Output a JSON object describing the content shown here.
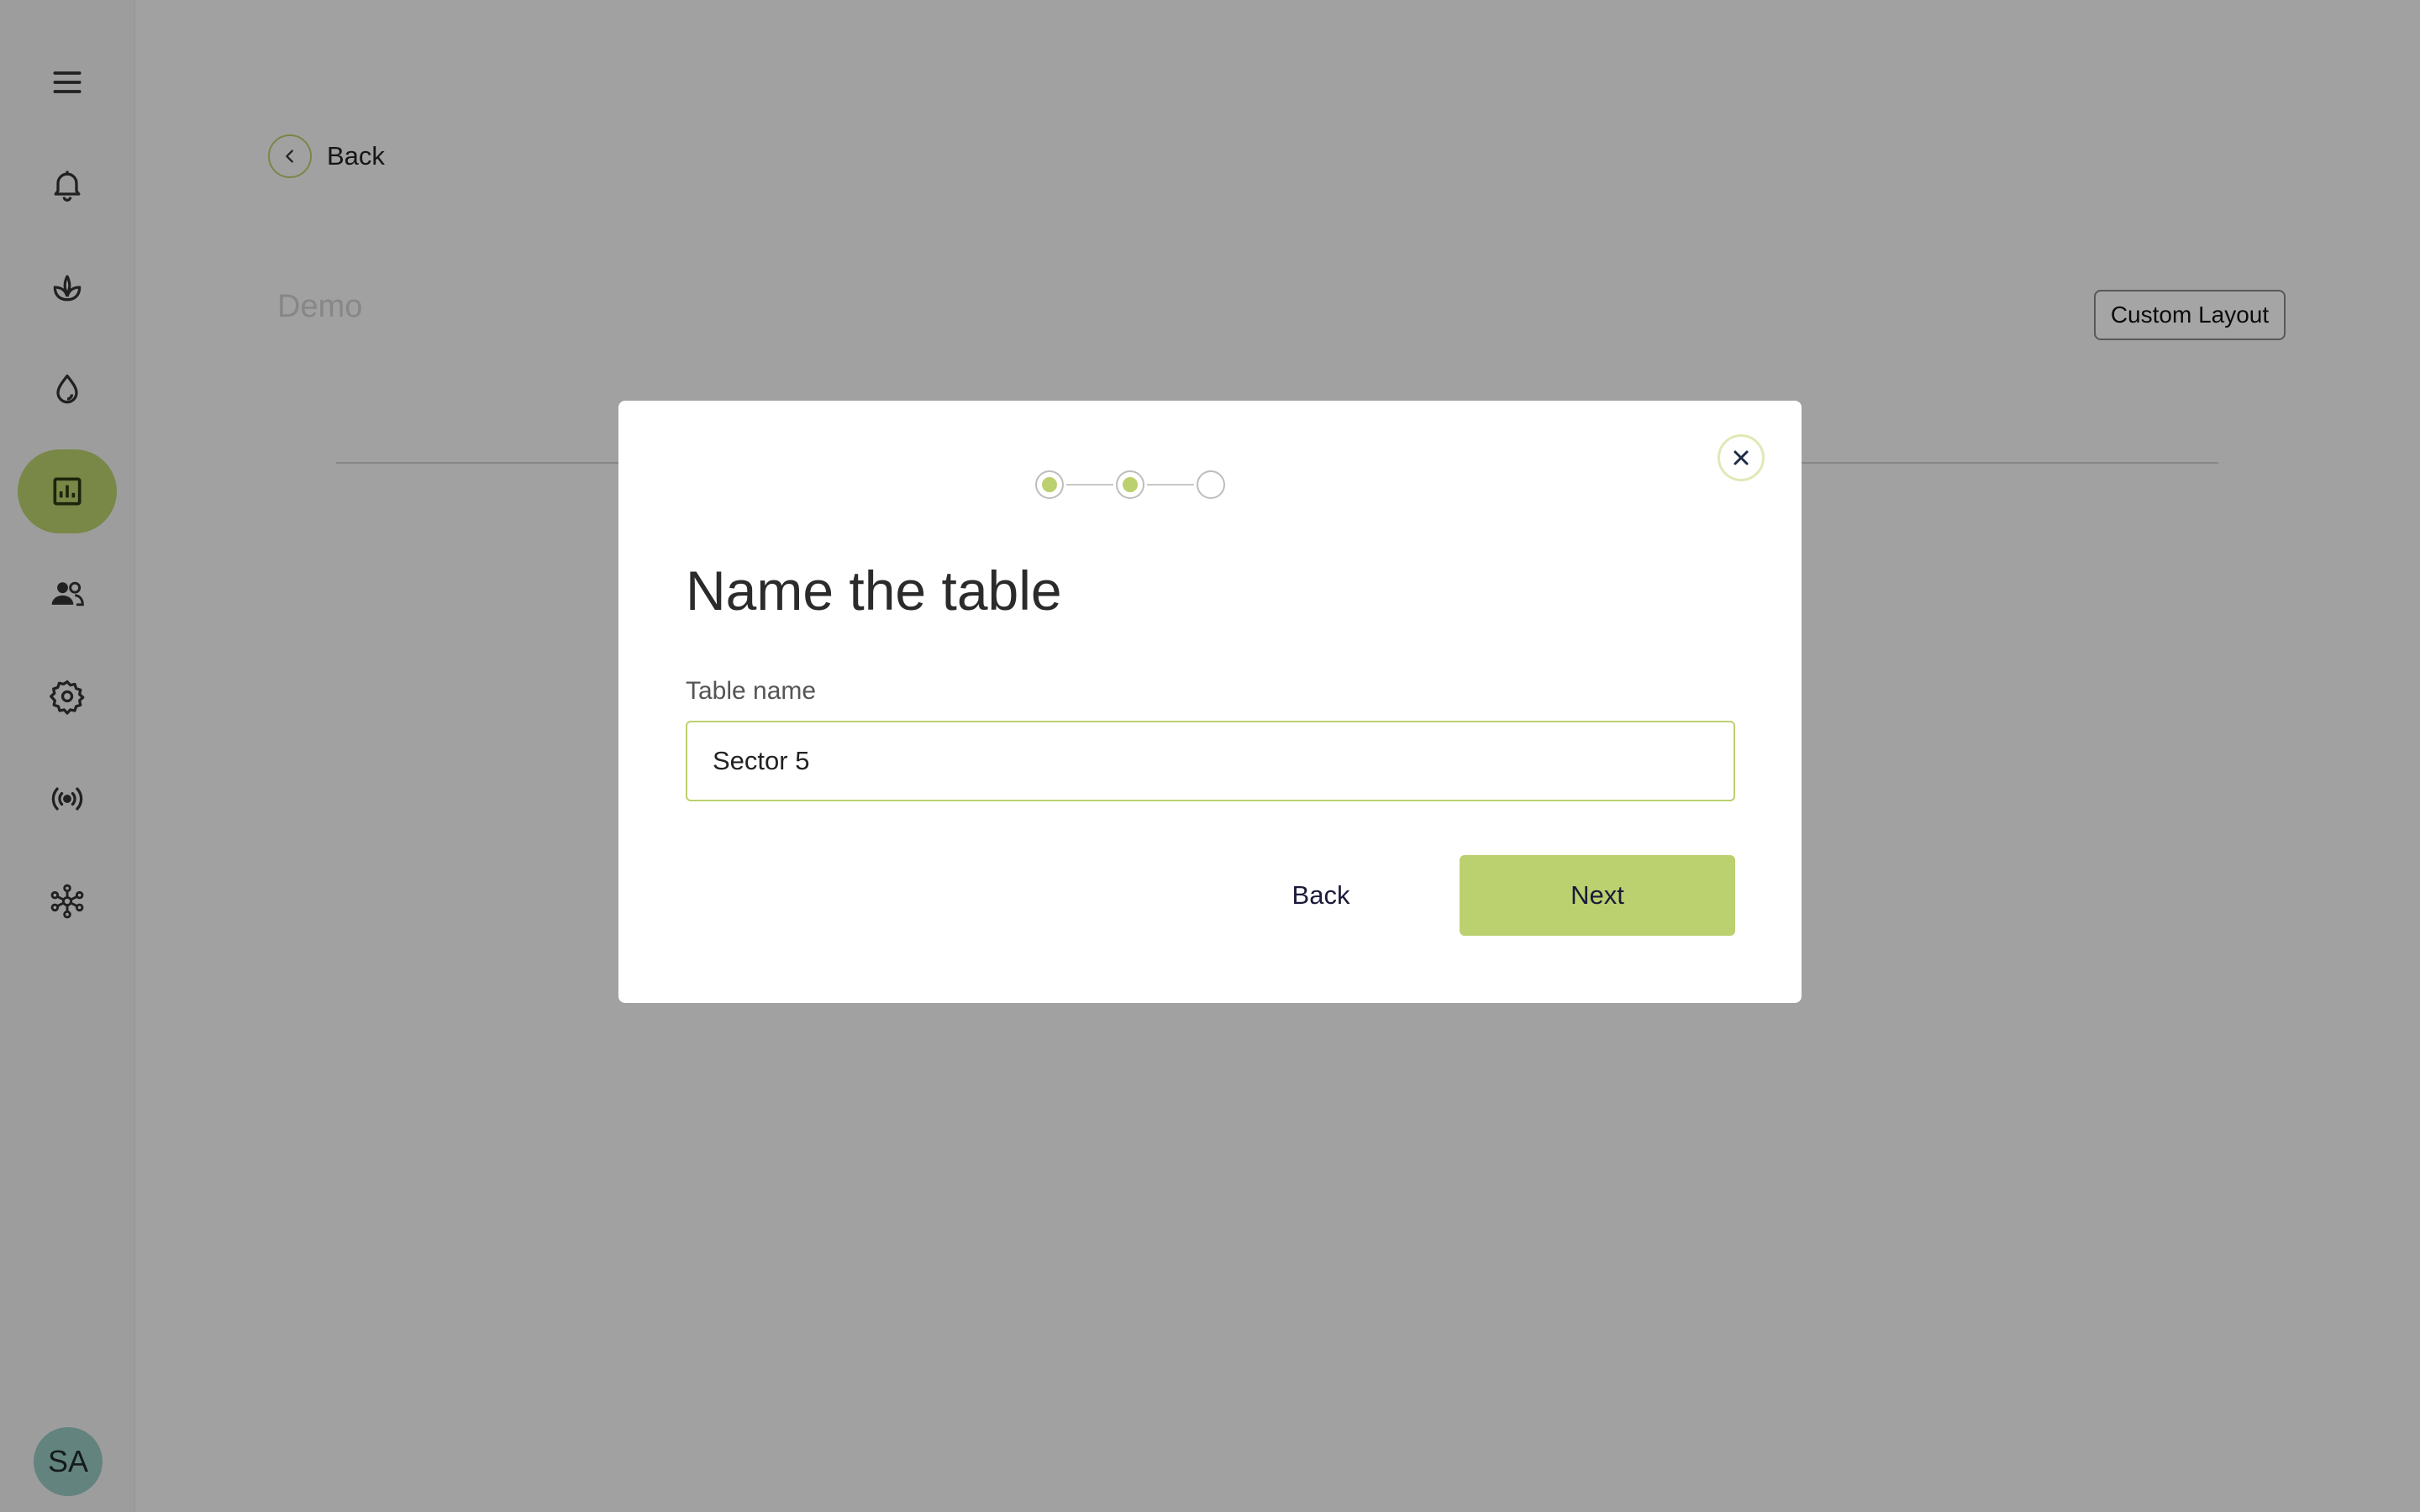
{
  "sidebar": {
    "items": [
      {
        "icon": "menu-icon"
      },
      {
        "icon": "bell-icon"
      },
      {
        "icon": "plant-icon"
      },
      {
        "icon": "water-drop-icon"
      },
      {
        "icon": "chart-icon",
        "active": true
      },
      {
        "icon": "users-icon"
      },
      {
        "icon": "gear-icon"
      },
      {
        "icon": "broadcast-icon"
      },
      {
        "icon": "network-icon"
      }
    ],
    "avatar_initials": "SA"
  },
  "main": {
    "back_label": "Back",
    "title": "Demo",
    "custom_layout_label": "Custom Layout"
  },
  "modal": {
    "steps": [
      {
        "state": "done"
      },
      {
        "state": "current"
      },
      {
        "state": "pending"
      }
    ],
    "title": "Name the table",
    "field_label": "Table name",
    "field_value": "Sector 5",
    "back_label": "Back",
    "next_label": "Next"
  },
  "colors": {
    "accent": "#bbd06e",
    "sidebar_bg": "#f2f2f2",
    "page_bg": "#f7f7f7"
  }
}
